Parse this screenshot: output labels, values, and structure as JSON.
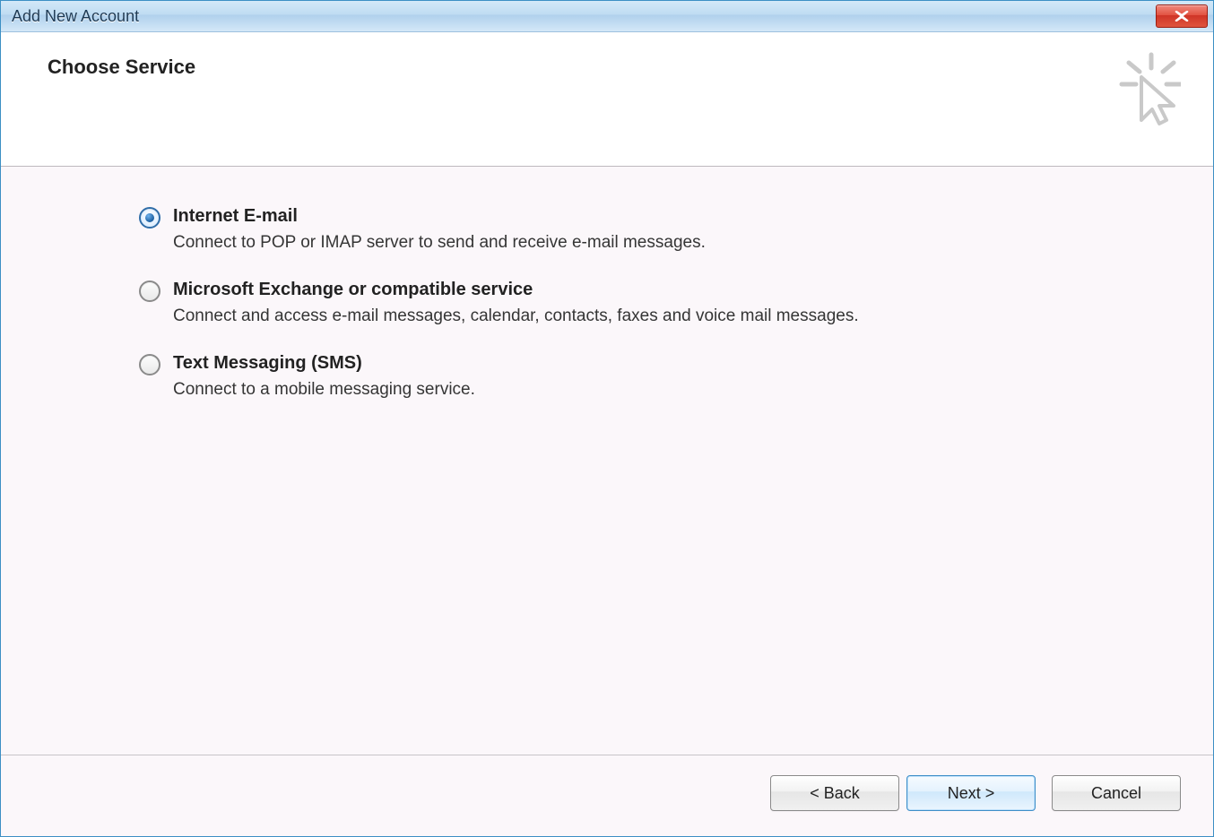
{
  "window": {
    "title": "Add New Account"
  },
  "header": {
    "title": "Choose Service"
  },
  "options": [
    {
      "label": "Internet E-mail",
      "description": "Connect to POP or IMAP server to send and receive e-mail messages.",
      "selected": true
    },
    {
      "label": "Microsoft Exchange or compatible service",
      "description": "Connect and access e-mail messages, calendar, contacts, faxes and voice mail messages.",
      "selected": false
    },
    {
      "label": "Text Messaging (SMS)",
      "description": "Connect to a mobile messaging service.",
      "selected": false
    }
  ],
  "buttons": {
    "back": "< Back",
    "next": "Next >",
    "cancel": "Cancel"
  }
}
